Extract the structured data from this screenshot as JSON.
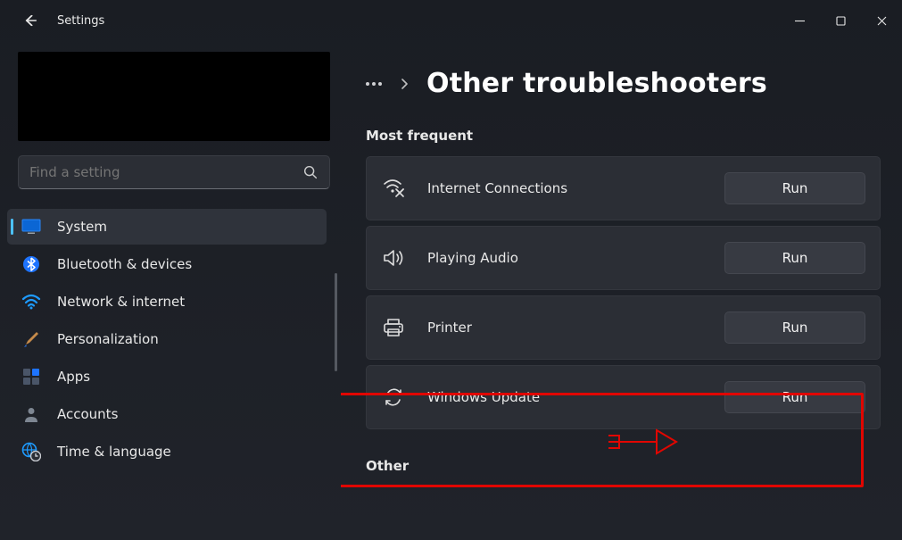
{
  "window": {
    "title": "Settings"
  },
  "search": {
    "placeholder": "Find a setting"
  },
  "nav": {
    "items": [
      {
        "label": "System",
        "icon": "system-icon",
        "active": true
      },
      {
        "label": "Bluetooth & devices",
        "icon": "bluetooth-icon",
        "active": false
      },
      {
        "label": "Network & internet",
        "icon": "wifi-icon",
        "active": false
      },
      {
        "label": "Personalization",
        "icon": "paintbrush-icon",
        "active": false
      },
      {
        "label": "Apps",
        "icon": "apps-icon",
        "active": false
      },
      {
        "label": "Accounts",
        "icon": "person-icon",
        "active": false
      },
      {
        "label": "Time & language",
        "icon": "globe-clock-icon",
        "active": false
      }
    ]
  },
  "page": {
    "title": "Other troubleshooters",
    "section_most_frequent": "Most frequent",
    "section_other": "Other"
  },
  "troubleshooters": [
    {
      "label": "Internet Connections",
      "icon": "net-diag-icon",
      "run": "Run",
      "highlighted": false
    },
    {
      "label": "Playing Audio",
      "icon": "speaker-icon",
      "run": "Run",
      "highlighted": false
    },
    {
      "label": "Printer",
      "icon": "printer-icon",
      "run": "Run",
      "highlighted": false
    },
    {
      "label": "Windows Update",
      "icon": "update-sync-icon",
      "run": "Run",
      "highlighted": true
    }
  ],
  "annotation": {
    "style": "red-box-and-arrow",
    "target": "Windows Update row + Run button"
  }
}
